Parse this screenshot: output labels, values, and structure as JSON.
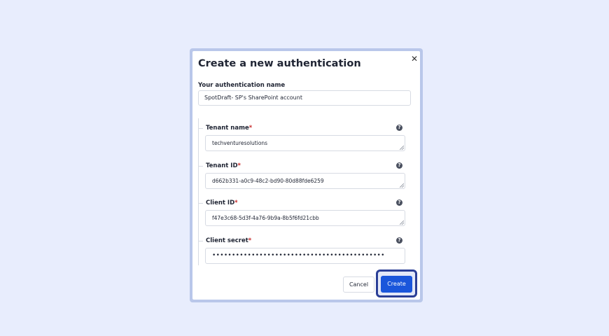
{
  "dialog": {
    "title": "Create a new authentication",
    "close_glyph": "✕",
    "name_label": "Your authentication name",
    "name_value": "SpotDraft- SP's SharePoint account"
  },
  "fields": [
    {
      "label": "Tenant name",
      "required_mark": "*",
      "value": "techventuresolutions",
      "help_glyph": "?"
    },
    {
      "label": "Tenant ID",
      "required_mark": "*",
      "value": "d662b331-a0c9-48c2-bd90-80d88fde6259",
      "help_glyph": "?"
    },
    {
      "label": "Client ID",
      "required_mark": "*",
      "value": "f47e3c68-5d3f-4a76-9b9a-8b5f6fd21cbb",
      "help_glyph": "?"
    },
    {
      "label": "Client secret",
      "required_mark": "*",
      "value": "••••••••••••••••••••••••••••••••••••••••••••",
      "help_glyph": "?"
    }
  ],
  "actions": {
    "cancel_label": "Cancel",
    "create_label": "Create"
  },
  "icons": {
    "close": "close-icon",
    "help": "question-circle-icon",
    "resize": "resize-grip-icon"
  },
  "colors": {
    "page_background": "#e8edfd",
    "primary": "#1a56db",
    "required": "#c62828",
    "highlight_border": "#2a3e96"
  }
}
